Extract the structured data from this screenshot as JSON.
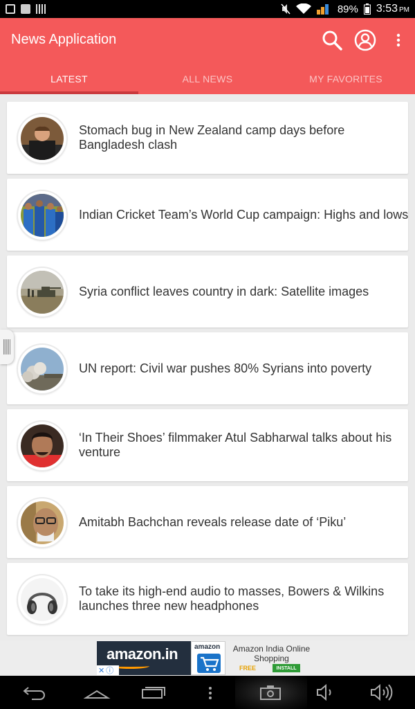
{
  "status_bar": {
    "battery": "89%",
    "time": "3:53",
    "ampm": "PM"
  },
  "app": {
    "title": "News Application"
  },
  "tabs": [
    {
      "label": "LATEST",
      "active": true
    },
    {
      "label": "ALL NEWS",
      "active": false
    },
    {
      "label": "MY FAVORITES",
      "active": false
    }
  ],
  "news": [
    {
      "headline": "Stomach bug in New Zealand camp days before Bangladesh clash",
      "thumb": "cricketer-photo"
    },
    {
      "headline": "Indian Cricket Team’s World Cup campaign: Highs and lows",
      "thumb": "team-photo"
    },
    {
      "headline": "Syria conflict leaves country in dark: Satellite images",
      "thumb": "tank-photo"
    },
    {
      "headline": "UN report: Civil war pushes 80% Syrians into poverty",
      "thumb": "smoke-photo"
    },
    {
      "headline": "‘In Their Shoes’ filmmaker Atul Sabharwal talks about his venture",
      "thumb": "portrait-photo"
    },
    {
      "headline": "Amitabh Bachchan reveals release date of ‘Piku’",
      "thumb": "actor-photo"
    },
    {
      "headline": "To take its high-end audio to masses, Bowers & Wilkins launches three new headphones",
      "thumb": "headphones-photo"
    }
  ],
  "ad": {
    "logo": "amazon.in",
    "icon_label": "amazon",
    "text": "Amazon India Online Shopping",
    "free": "FREE",
    "install": "INSTALL"
  },
  "colors": {
    "primary": "#f4595a",
    "indicator": "#c9393d"
  }
}
